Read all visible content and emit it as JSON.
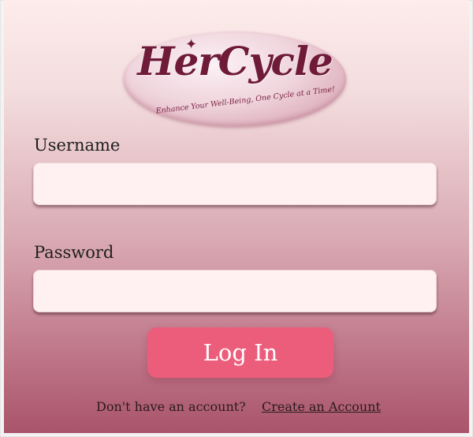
{
  "logo": {
    "title": "HerCycle",
    "star": "✦",
    "tagline": "Enhance Your Well-Being, One Cycle at a Time!"
  },
  "form": {
    "username_label": "Username",
    "username_value": "",
    "password_label": "Password",
    "password_value": "",
    "login_label": "Log In"
  },
  "footer": {
    "prompt": "Don't have an account?",
    "create_account_label": "Create an Account"
  },
  "colors": {
    "brand": "#6e1a38",
    "button": "#ec5d7b",
    "input_background": "#fff1f1"
  }
}
